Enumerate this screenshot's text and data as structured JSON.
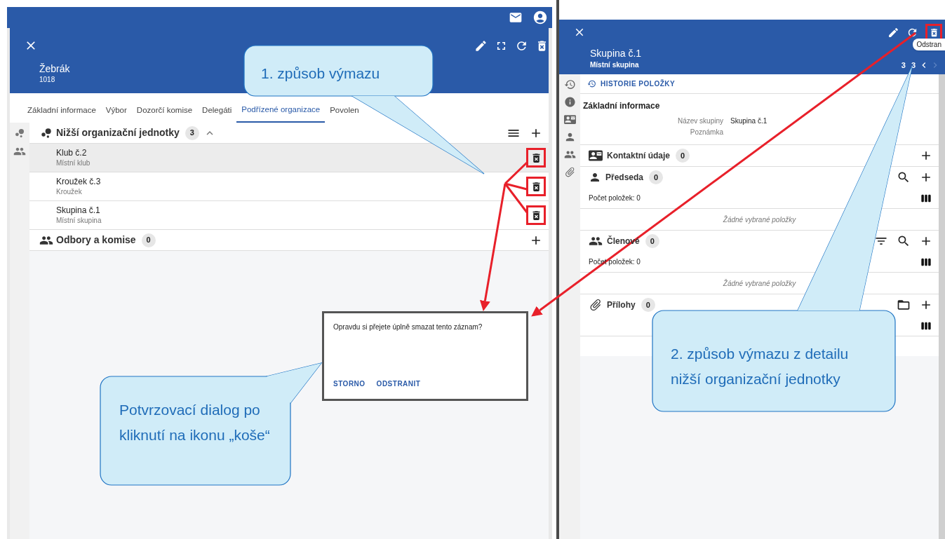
{
  "left_window": {
    "title": "Žebrák",
    "subtitle": "1018",
    "tabs": [
      {
        "label": "Základní informace",
        "selected": false
      },
      {
        "label": "Výbor",
        "selected": false
      },
      {
        "label": "Dozorčí komise",
        "selected": false
      },
      {
        "label": "Delegáti",
        "selected": false
      },
      {
        "label": "Podřízené organizace",
        "selected": true
      },
      {
        "label": "Povolen",
        "selected": false
      }
    ],
    "sections": [
      {
        "kind": "units",
        "title": "Nižší organizační jednotky",
        "count": "3",
        "expanded": true,
        "items": [
          {
            "name": "Klub č.2",
            "type": "Místní klub",
            "selected": true,
            "annotated": true
          },
          {
            "name": "Kroužek č.3",
            "type": "Kroužek",
            "selected": false,
            "annotated": true
          },
          {
            "name": "Skupina č.1",
            "type": "Místní skupina",
            "selected": false,
            "annotated": true
          }
        ]
      },
      {
        "kind": "departments",
        "title": "Odbory a komise",
        "count": "0"
      }
    ],
    "dialog": {
      "message": "Opravdu si přejete úplně smazat tento záznam?",
      "buttons": [
        "STORNO",
        "ODSTRANIT"
      ]
    }
  },
  "right_window": {
    "title": "Skupina č.1",
    "subtitle": "Místní skupina",
    "pager": {
      "current": "3",
      "total": "3"
    },
    "delete_annotated": true,
    "tooltip": "Odstran",
    "history_button": "HISTORIE POLOŽKY",
    "basic_info": {
      "title": "Základní informace",
      "fields": [
        {
          "label": "Název skupiny",
          "value": "Skupina č.1"
        },
        {
          "label": "Poznámka"
        }
      ]
    },
    "sections": [
      {
        "kind": "contacts",
        "title": "Kontaktní údaje",
        "count": "0"
      },
      {
        "kind": "chair",
        "title": "Předseda",
        "count": "0",
        "summary": "Počet položek: 0",
        "columns": true,
        "empty_text": "Žádné vybrané položky"
      },
      {
        "kind": "members",
        "title": "Členové",
        "count": "0",
        "summary": "Počet položek: 0",
        "columns": true,
        "empty_text": "Žádné vybrané položky"
      },
      {
        "kind": "attachments",
        "title": "Přílohy",
        "count": "0",
        "columns": true
      }
    ]
  },
  "callouts": [
    {
      "text": "1. způsob výmazu"
    },
    {
      "text": "2. způsob výmazu z detailu nižší organizační jednotky"
    },
    {
      "text": "Potvrzovací dialog po kliknutí na ikonu „koše“"
    }
  ]
}
